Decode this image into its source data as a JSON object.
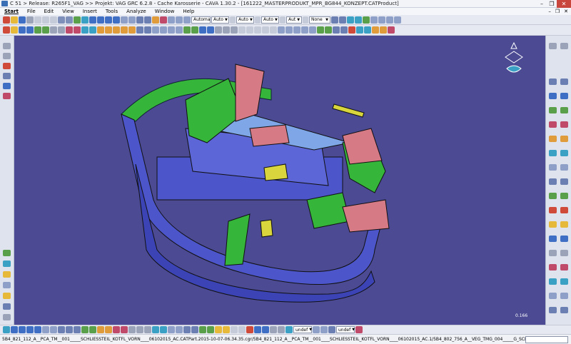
{
  "window": {
    "title": "C 51 > Release: R265F1_VAG  >>  Projekt: VAG GRC 6.2.8 - Cache Karosserie - CAVA 1.30.2  - [161222_MASTERPRODUKT_MPR_BG844_KONZEPT.CATProduct]",
    "min_glyph": "–",
    "max_glyph": "❐",
    "close_glyph": "✕"
  },
  "menu": {
    "items": [
      "Start",
      "File",
      "Edit",
      "View",
      "Insert",
      "Tools",
      "Analyze",
      "Window",
      "Help"
    ],
    "mdi": [
      "–",
      "❐",
      "✕"
    ]
  },
  "toolbar1": {
    "dropdowns": [
      "Automa",
      "Auto",
      "Auto",
      "Auto",
      "Aut",
      "None"
    ]
  },
  "viewport": {
    "background": "#4b4a93",
    "scale_text": "0.166"
  },
  "bottombar": {
    "dropdowns": [
      "undef",
      "undef"
    ]
  },
  "status": {
    "text": "5B4_821_112_A__PCA_TM__001_____SCHLIESSTEIL_KOTFL_VORN____06102015_AC.CATPart.2015-10-07-06.34.35.cgr/5B4_821_112_A__PCA_TM__001____SCHLIESSTEIL_KOTFL_VORN____06102015_AC.1/5B4_802_756_A__VEG_TMG_004_____G_SCHLIESSTEIL_KOTFL_VORN____06102015_AC.1 preselec"
  },
  "colors": {
    "blue_part": "#4c55c9",
    "green_part": "#35b53a",
    "pink_part": "#d67a86",
    "yellow_part": "#d8d63c",
    "light_blue_part": "#7fa6e6"
  },
  "icons": [
    "compass-icon",
    "fit-all-icon",
    "pan-icon",
    "rotate-icon",
    "zoom-in-icon",
    "zoom-out-icon",
    "normal-view-icon",
    "iso-view-icon",
    "shading-icon",
    "hide-show-icon",
    "measure-icon",
    "section-icon"
  ]
}
